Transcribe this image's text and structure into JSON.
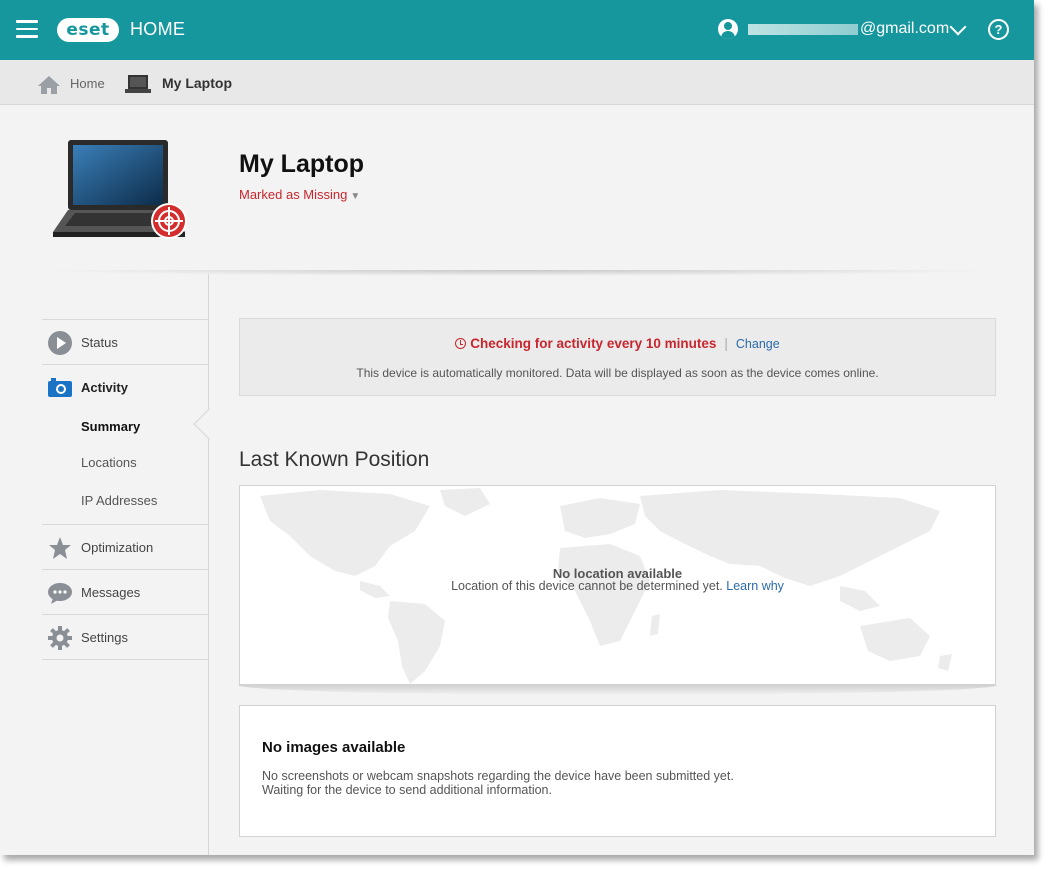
{
  "topbar": {
    "logo_text": "eset",
    "product": "HOME",
    "email_suffix": "@gmail.com"
  },
  "breadcrumb": {
    "home": "Home",
    "current": "My Laptop"
  },
  "device": {
    "title": "My Laptop",
    "status": "Marked as Missing",
    "status_color": "#c8262e"
  },
  "sidebar": {
    "items": [
      {
        "label": "Status",
        "icon": "play-circle-icon"
      },
      {
        "label": "Activity",
        "icon": "camera-icon"
      },
      {
        "label": "Optimization",
        "icon": "star-icon"
      },
      {
        "label": "Messages",
        "icon": "chat-bubble-icon"
      },
      {
        "label": "Settings",
        "icon": "gear-icon"
      }
    ],
    "sub_items": [
      "Summary",
      "Locations",
      "IP Addresses"
    ]
  },
  "info": {
    "checking": "Checking for activity every 10 minutes",
    "separator": "|",
    "change": "Change",
    "description": "This device is automatically monitored. Data will be displayed as soon as the device comes online."
  },
  "position": {
    "title": "Last Known Position",
    "no_location": "No location available",
    "message": "Location of this device cannot be determined yet.",
    "learn": "Learn why"
  },
  "images": {
    "title": "No images available",
    "line1": "No screenshots or webcam snapshots regarding the device have been submitted yet.",
    "line2": "Waiting for the device to send additional information."
  },
  "colors": {
    "brand": "#16979e",
    "alert": "#c8262e",
    "link": "#2c6aa8"
  }
}
